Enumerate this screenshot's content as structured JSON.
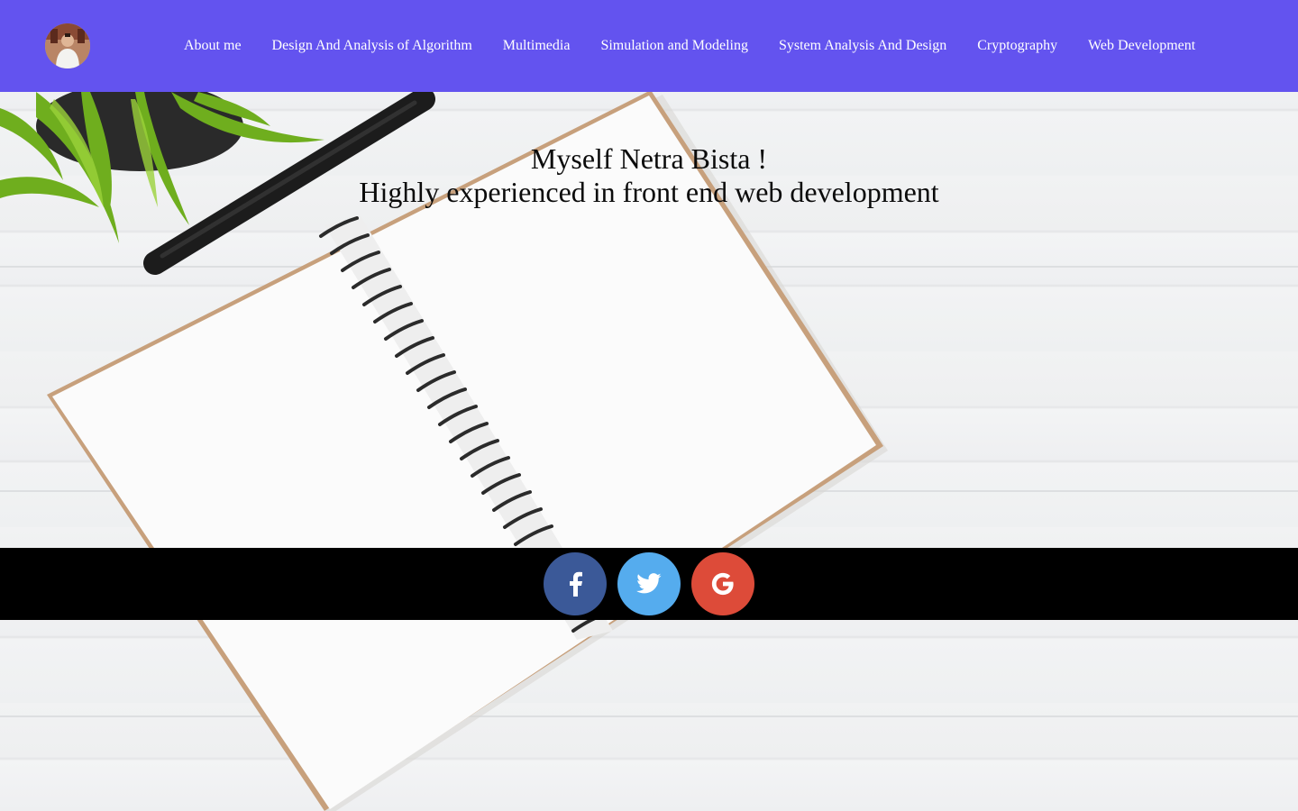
{
  "header": {
    "avatar_alt": "profile photo",
    "nav": [
      {
        "label": "About me"
      },
      {
        "label": "Design And Analysis of Algorithm"
      },
      {
        "label": "Multimedia"
      },
      {
        "label": "Simulation and Modeling"
      },
      {
        "label": "System Analysis And Design"
      },
      {
        "label": "Cryptography"
      },
      {
        "label": "Web Development"
      }
    ],
    "background_color": "#6353ef"
  },
  "hero": {
    "line1": "Myself Netra Bista !",
    "line2": "Highly experienced in front end web development"
  },
  "social": {
    "items": [
      {
        "name": "facebook-icon",
        "color": "#3b5998"
      },
      {
        "name": "twitter-icon",
        "color": "#55acee"
      },
      {
        "name": "google-icon",
        "color": "#dd4b39"
      }
    ]
  }
}
